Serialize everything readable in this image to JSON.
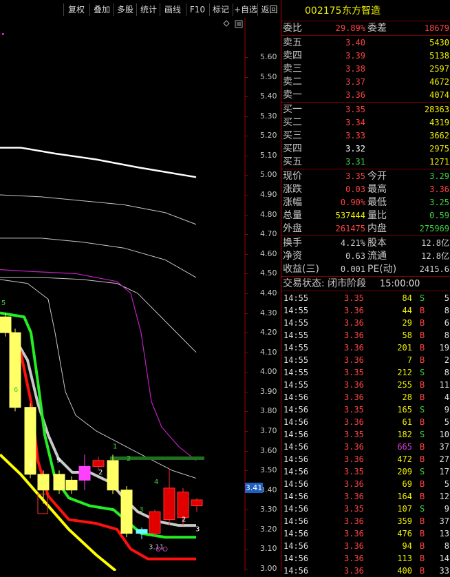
{
  "toolbar": {
    "buttons": [
      "复权",
      "叠加",
      "多股",
      "统计",
      "画线",
      "F10",
      "标记",
      "+自选",
      "返回"
    ]
  },
  "chart": {
    "price_ticks": [
      "5.60",
      "5.50",
      "5.40",
      "5.30",
      "5.20",
      "5.10",
      "5.00",
      "4.90",
      "4.80",
      "4.70",
      "4.60",
      "4.50",
      "4.40",
      "4.30",
      "4.20",
      "4.10",
      "4.00",
      "3.90",
      "3.80",
      "3.70",
      "3.60",
      "3.50",
      "3.40",
      "3.30",
      "3.20",
      "3.10",
      "3.00"
    ],
    "current_price_tag": "3.41",
    "candle_labels": [
      "5",
      "6",
      "7",
      "9",
      "1",
      "2",
      "2",
      "3",
      "4",
      "2",
      "3",
      "3.11",
      "7"
    ],
    "colors": {
      "up": "#ff3030",
      "down_fill": "#ffff66",
      "ma_white": "#ffffff",
      "ma_gray": "#c8c8c8",
      "ma_green": "#22ee22",
      "ma_red": "#ff1010",
      "ma_yellow": "#ffff00",
      "band_purple": "#c020c0"
    }
  },
  "panel": {
    "code": "002175",
    "name": "东方智造",
    "weibi_label": "委比",
    "weibi": "29.89%",
    "weicha_label": "委差",
    "weicha": "18679",
    "sell": [
      {
        "label": "卖五",
        "price": "3.40",
        "vol": "5430"
      },
      {
        "label": "卖四",
        "price": "3.39",
        "vol": "5138"
      },
      {
        "label": "卖三",
        "price": "3.38",
        "vol": "2597"
      },
      {
        "label": "卖二",
        "price": "3.37",
        "vol": "4672"
      },
      {
        "label": "卖一",
        "price": "3.36",
        "vol": "4074"
      }
    ],
    "buy": [
      {
        "label": "买一",
        "price": "3.35",
        "vol": "28363",
        "color": "red"
      },
      {
        "label": "买二",
        "price": "3.34",
        "vol": "4319",
        "color": "red"
      },
      {
        "label": "买三",
        "price": "3.33",
        "vol": "3662",
        "color": "red"
      },
      {
        "label": "买四",
        "price": "3.32",
        "vol": "2975",
        "color": "white"
      },
      {
        "label": "买五",
        "price": "3.31",
        "vol": "1271",
        "color": "green"
      }
    ],
    "stats": [
      {
        "l1": "现价",
        "v1": "3.35",
        "c1": "red",
        "l2": "今开",
        "v2": "3.29",
        "c2": "green"
      },
      {
        "l1": "涨跌",
        "v1": "0.03",
        "c1": "red",
        "l2": "最高",
        "v2": "3.36",
        "c2": "red"
      },
      {
        "l1": "涨幅",
        "v1": "0.90%",
        "c1": "red",
        "l2": "最低",
        "v2": "3.25",
        "c2": "green"
      },
      {
        "l1": "总量",
        "v1": "537444",
        "c1": "yellow",
        "l2": "量比",
        "v2": "0.59",
        "c2": "green"
      },
      {
        "l1": "外盘",
        "v1": "261475",
        "c1": "red",
        "l2": "内盘",
        "v2": "275969",
        "c2": "green"
      }
    ],
    "stats2": [
      {
        "l1": "换手",
        "v1": "4.21%",
        "l2": "股本",
        "v2": "12.8亿"
      },
      {
        "l1": "净资",
        "v1": "0.63",
        "l2": "流通",
        "v2": "12.8亿"
      },
      {
        "l1": "收益(三)",
        "v1": "0.001",
        "l2": "PE(动)",
        "v2": "2415.6"
      }
    ],
    "status_label": "交易状态: 闭市阶段",
    "status_time": "15:00:00",
    "trades": [
      {
        "t": "14:55",
        "p": "3.35",
        "v": "84",
        "s": "S",
        "n": "5"
      },
      {
        "t": "14:55",
        "p": "3.36",
        "v": "44",
        "s": "B",
        "n": "8"
      },
      {
        "t": "14:55",
        "p": "3.36",
        "v": "29",
        "s": "B",
        "n": "6"
      },
      {
        "t": "14:55",
        "p": "3.36",
        "v": "58",
        "s": "B",
        "n": "8"
      },
      {
        "t": "14:55",
        "p": "3.36",
        "v": "201",
        "s": "B",
        "n": "19"
      },
      {
        "t": "14:55",
        "p": "3.36",
        "v": "7",
        "s": "B",
        "n": "2"
      },
      {
        "t": "14:55",
        "p": "3.35",
        "v": "212",
        "s": "S",
        "n": "8"
      },
      {
        "t": "14:55",
        "p": "3.36",
        "v": "255",
        "s": "B",
        "n": "11"
      },
      {
        "t": "14:56",
        "p": "3.36",
        "v": "28",
        "s": "B",
        "n": "4"
      },
      {
        "t": "14:56",
        "p": "3.35",
        "v": "165",
        "s": "S",
        "n": "9"
      },
      {
        "t": "14:56",
        "p": "3.36",
        "v": "61",
        "s": "B",
        "n": "5"
      },
      {
        "t": "14:56",
        "p": "3.35",
        "v": "182",
        "s": "S",
        "n": "10"
      },
      {
        "t": "14:56",
        "p": "3.36",
        "v": "665",
        "s": "B",
        "n": "37",
        "vc": "purple"
      },
      {
        "t": "14:56",
        "p": "3.36",
        "v": "472",
        "s": "B",
        "n": "27"
      },
      {
        "t": "14:56",
        "p": "3.35",
        "v": "209",
        "s": "S",
        "n": "17"
      },
      {
        "t": "14:56",
        "p": "3.36",
        "v": "69",
        "s": "B",
        "n": "5"
      },
      {
        "t": "14:56",
        "p": "3.36",
        "v": "164",
        "s": "B",
        "n": "12"
      },
      {
        "t": "14:56",
        "p": "3.35",
        "v": "107",
        "s": "S",
        "n": "9"
      },
      {
        "t": "14:56",
        "p": "3.36",
        "v": "359",
        "s": "B",
        "n": "37"
      },
      {
        "t": "14:56",
        "p": "3.36",
        "v": "476",
        "s": "B",
        "n": "13"
      },
      {
        "t": "14:56",
        "p": "3.36",
        "v": "94",
        "s": "B",
        "n": "8"
      },
      {
        "t": "14:56",
        "p": "3.36",
        "v": "113",
        "s": "B",
        "n": "14"
      },
      {
        "t": "14:56",
        "p": "3.36",
        "v": "400",
        "s": "B",
        "n": "33"
      }
    ]
  }
}
